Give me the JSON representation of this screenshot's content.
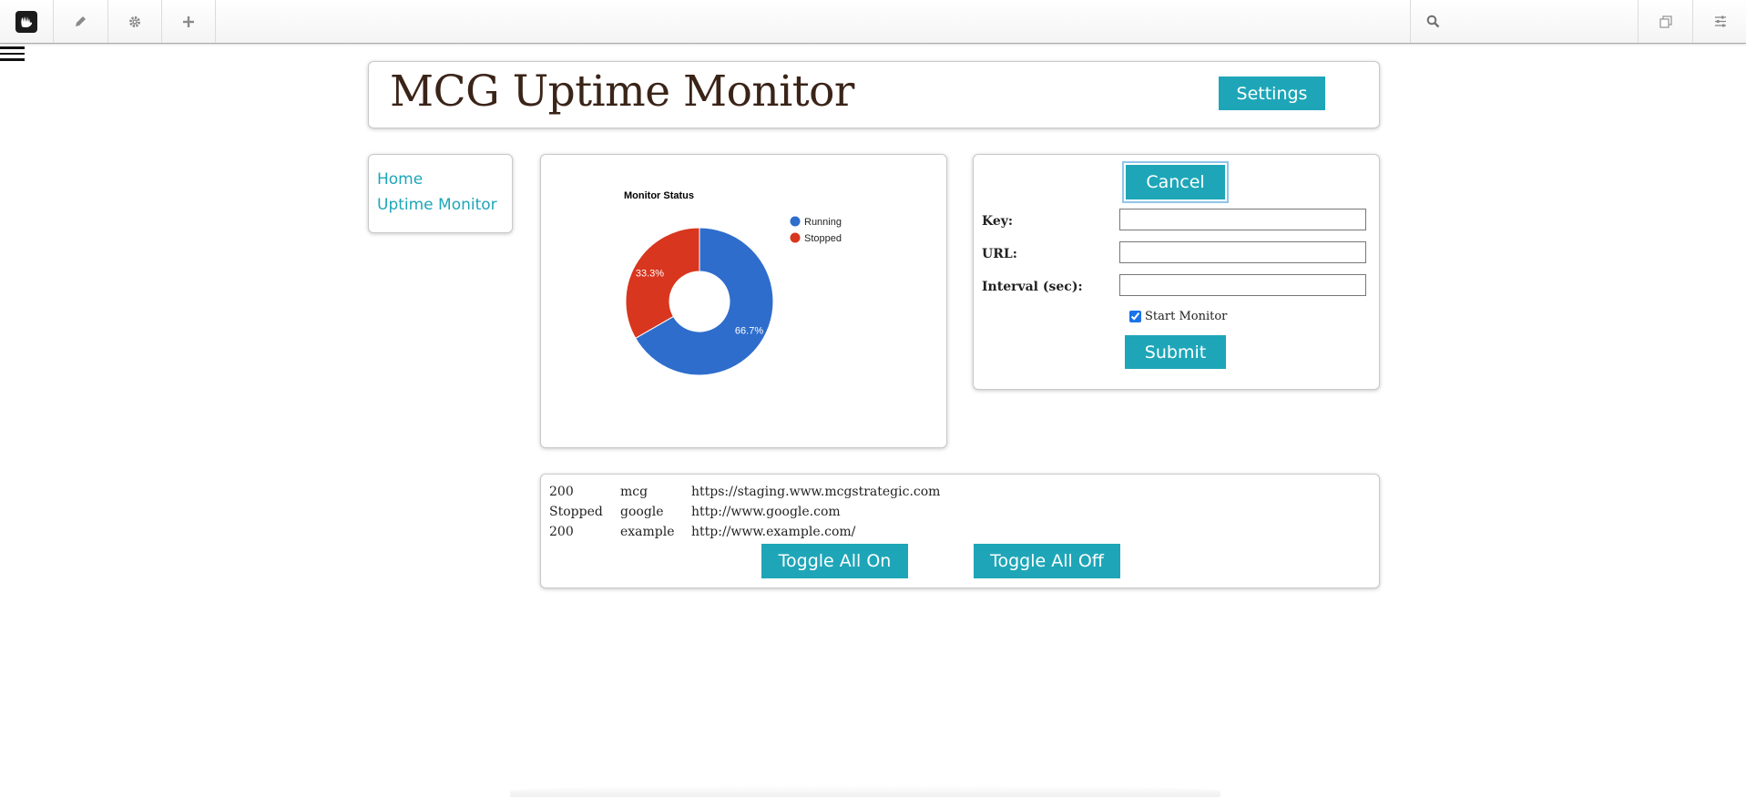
{
  "header": {
    "title": "MCG Uptime Monitor",
    "settings_label": "Settings"
  },
  "nav": {
    "items": [
      {
        "label": "Home"
      },
      {
        "label": "Uptime Monitor"
      }
    ]
  },
  "form": {
    "cancel_label": "Cancel",
    "key_label": "Key:",
    "key_value": "",
    "url_label": "URL:",
    "url_value": "",
    "interval_label": "Interval (sec):",
    "interval_value": "",
    "start_monitor_label": "Start Monitor",
    "start_monitor_checked": true,
    "submit_label": "Submit"
  },
  "monitors": {
    "rows": [
      {
        "status": "200",
        "key": "mcg",
        "url": "https://staging.www.mcgstrategic.com"
      },
      {
        "status": "Stopped",
        "key": "google",
        "url": "http://www.google.com"
      },
      {
        "status": "200",
        "key": "example",
        "url": "http://www.example.com/"
      }
    ],
    "toggle_on_label": "Toggle All On",
    "toggle_off_label": "Toggle All Off"
  },
  "chart_data": {
    "type": "pie",
    "title": "Monitor Status",
    "categories": [
      "Running",
      "Stopped"
    ],
    "values": [
      66.7,
      33.3
    ],
    "labels": [
      "66.7%",
      "33.3%"
    ],
    "colors": [
      "#2e6dcc",
      "#d8361f"
    ],
    "donut": true,
    "legend": "right"
  },
  "icons": {
    "toolbar": [
      "concrete5-logo-icon",
      "pencil-icon",
      "gear-icon",
      "plus-icon",
      "search-icon",
      "pages-icon",
      "sliders-icon"
    ],
    "menu": "hamburger-icon"
  }
}
